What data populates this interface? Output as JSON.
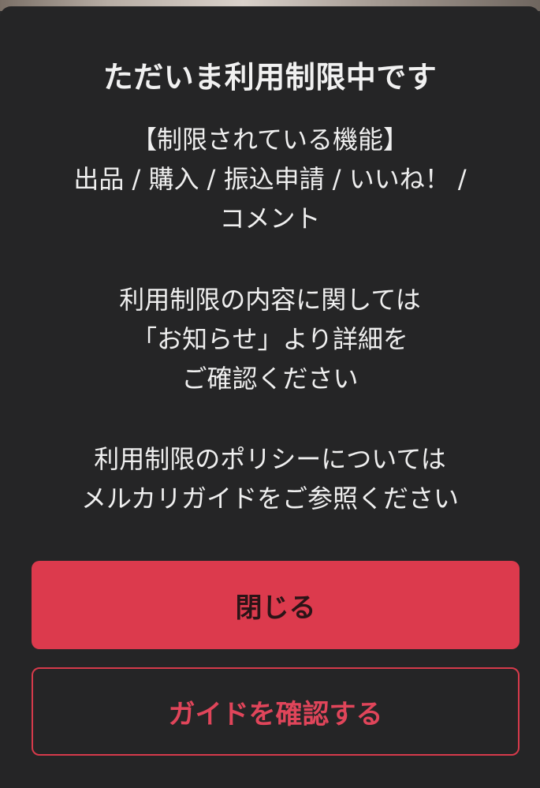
{
  "dialog": {
    "title": "ただいま利用制限中です",
    "restricted_block": [
      "【制限されている機能】",
      "出品 / 購入 / 振込申請 / いいね！ /",
      "コメント"
    ],
    "notice_block": [
      "利用制限の内容に関しては",
      "「お知らせ」より詳細を",
      "ご確認ください"
    ],
    "policy_block": [
      "利用制限のポリシーについては",
      "メルカリガイドをご参照ください"
    ],
    "close_button": "閉じる",
    "guide_button": "ガイドを確認する"
  },
  "colors": {
    "dialog_bg": "#252526",
    "accent": "#dc3a4d",
    "text": "#efefef"
  }
}
